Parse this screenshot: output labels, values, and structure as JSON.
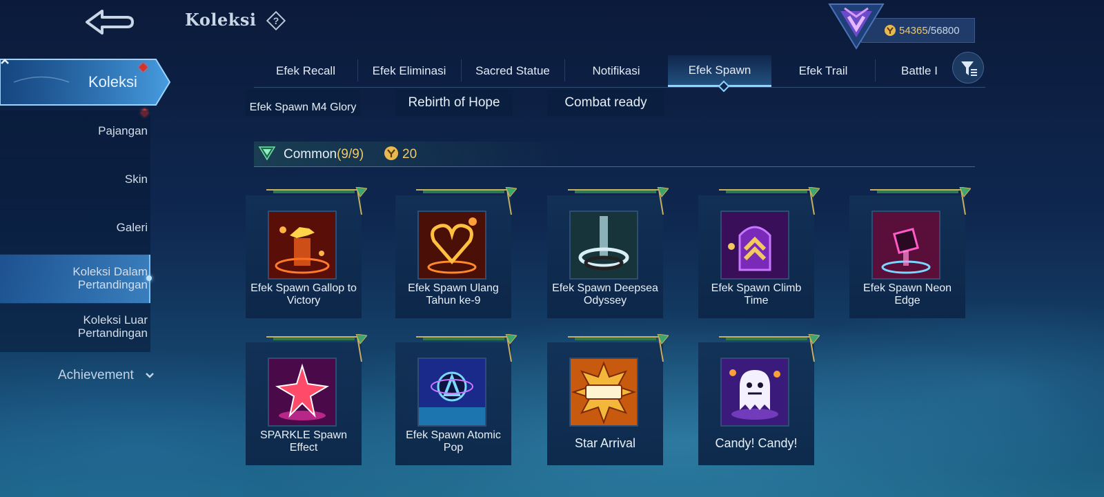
{
  "header": {
    "title": "Koleksi"
  },
  "currency": {
    "current": "54365",
    "max": "/56800"
  },
  "sidebar": {
    "main_label": "Koleksi",
    "items": [
      "Pajangan",
      "Skin",
      "Galeri",
      "Koleksi Dalam Pertandingan",
      "Koleksi Luar Pertandingan"
    ],
    "achievement": "Achievement"
  },
  "tabs": [
    "Efek Recall",
    "Efek Eliminasi",
    "Sacred Statue",
    "Notifikasi",
    "Efek Spawn",
    "Efek Trail",
    "Battle I"
  ],
  "active_tab": "Efek Spawn",
  "partial_row": [
    "Efek Spawn M4 Glory",
    "Rebirth of Hope",
    "Combat ready"
  ],
  "section": {
    "label": "Common",
    "count": "(9/9)",
    "points": "20"
  },
  "items": [
    {
      "name": "Efek Spawn Gallop to Victory",
      "icon": "golden-horse-effect-icon"
    },
    {
      "name": "Efek Spawn Ulang Tahun ke-9",
      "icon": "fire-heart-icon"
    },
    {
      "name": "Efek Spawn Deepsea Odyssey",
      "icon": "water-swirl-icon"
    },
    {
      "name": "Efek Spawn Climb Time",
      "icon": "rank-chevron-icon"
    },
    {
      "name": "Efek Spawn Neon Edge",
      "icon": "neon-cube-icon"
    },
    {
      "name": "SPARKLE Spawn Effect",
      "icon": "sparkle-star-icon"
    },
    {
      "name": "Efek Spawn Atomic Pop",
      "icon": "atomic-pop-icon"
    },
    {
      "name": "Star Arrival",
      "icon": "goal-burst-icon"
    },
    {
      "name": "Candy! Candy!",
      "icon": "ghost-candy-icon"
    }
  ],
  "colors": {
    "accent": "#8fd6ff",
    "gold": "#f0c86a",
    "alert": "#d6322c"
  }
}
